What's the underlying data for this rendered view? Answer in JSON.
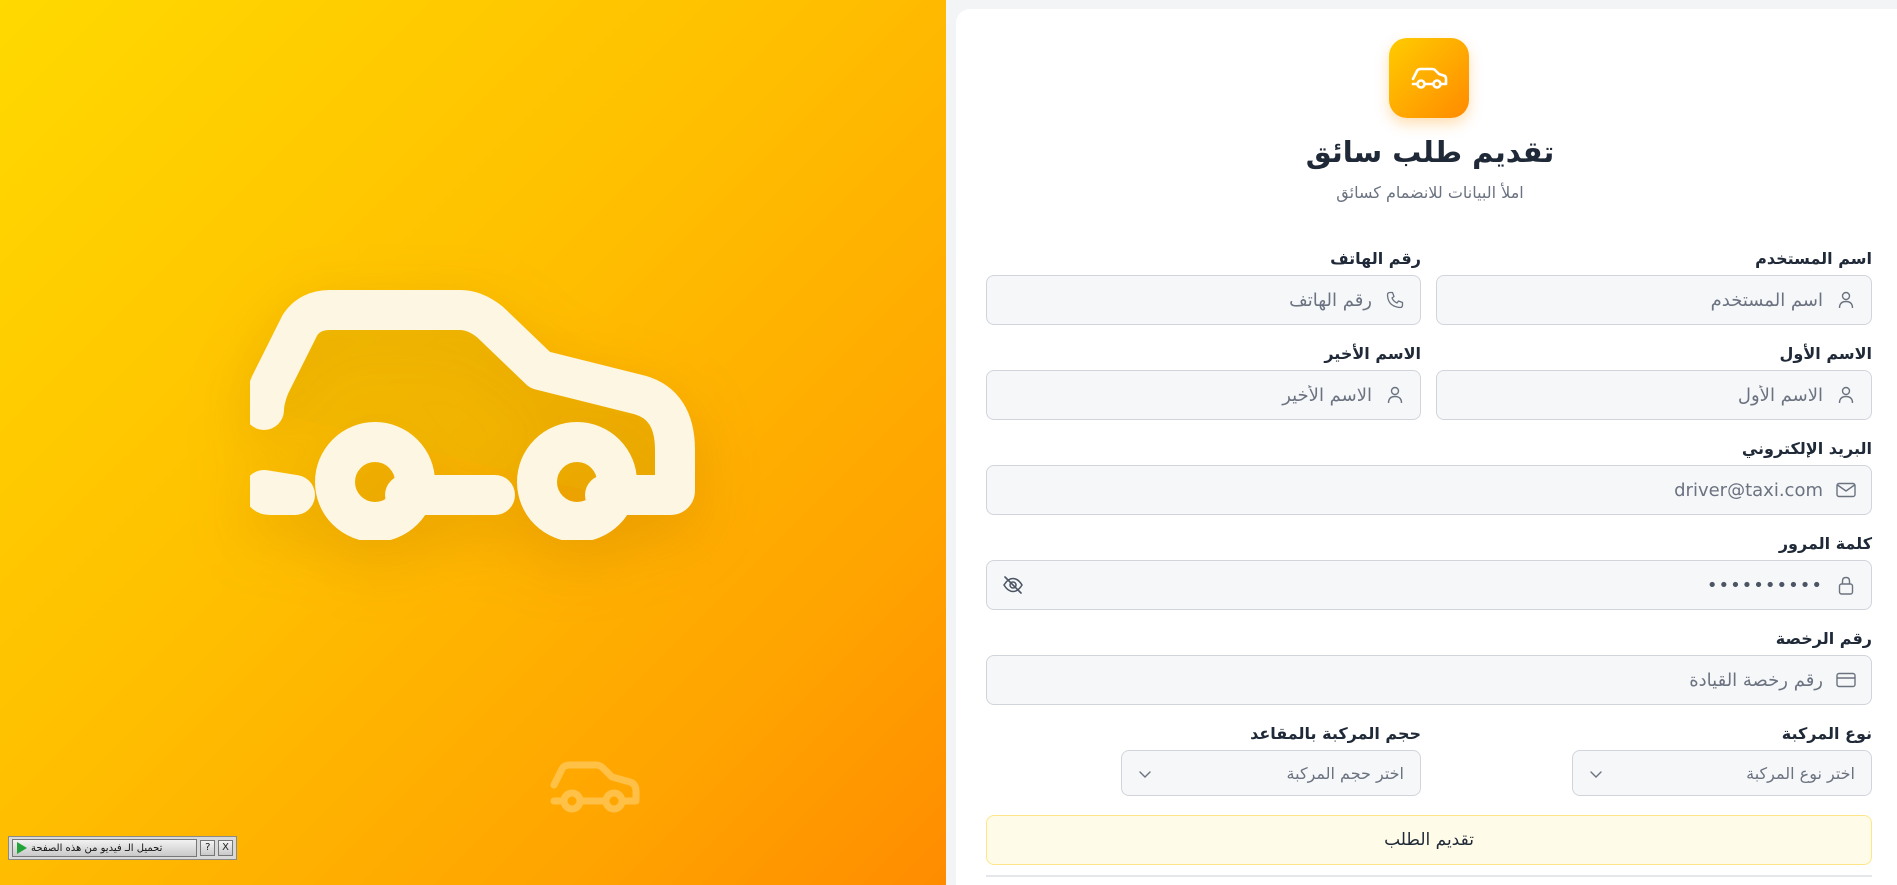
{
  "hero": {
    "big_icon": "car-icon",
    "small_icon": "car-icon",
    "gradient": [
      "#ffd900",
      "#ffbf00",
      "#ff8c00"
    ]
  },
  "video_toolbar": {
    "download_label": "تحميل الـ فيديو من هذه الصفحة",
    "help_label": "?",
    "close_label": "X"
  },
  "header": {
    "logo_icon": "car-icon",
    "title": "تقديم طلب سائق",
    "subtitle": "املأ البيانات للانضمام كسائق"
  },
  "form": {
    "username": {
      "label": "اسم المستخدم",
      "placeholder": "اسم المستخدم",
      "icon": "user-icon"
    },
    "phone": {
      "label": "رقم الهاتف",
      "placeholder": "رقم الهاتف",
      "icon": "phone-icon"
    },
    "first_name": {
      "label": "الاسم الأول",
      "placeholder": "الاسم الأول",
      "icon": "user-icon"
    },
    "last_name": {
      "label": "الاسم الأخير",
      "placeholder": "الاسم الأخير",
      "icon": "user-icon"
    },
    "email": {
      "label": "البريد الإلكتروني",
      "placeholder": "driver@taxi.com",
      "icon": "mail-icon"
    },
    "password": {
      "label": "كلمة المرور",
      "value": "••••••••••",
      "icon": "lock-icon",
      "toggle_icon": "eye-off-icon"
    },
    "license": {
      "label": "رقم الرخصة",
      "placeholder": "رقم رخصة القيادة",
      "icon": "credit-card-icon"
    },
    "vehicle_type": {
      "label": "نوع المركبة",
      "placeholder": "اختر نوع المركبة",
      "icon": "chevron-down-icon"
    },
    "vehicle_size": {
      "label": "حجم المركبة بالمقاعد",
      "placeholder": "اختر حجم المركبة",
      "icon": "chevron-down-icon"
    },
    "submit_label": "تقديم الطلب"
  },
  "colors": {
    "accent": "#ffa800",
    "submit_bg": "#fefce8",
    "text": "#1f2937",
    "muted": "#6b7280"
  }
}
